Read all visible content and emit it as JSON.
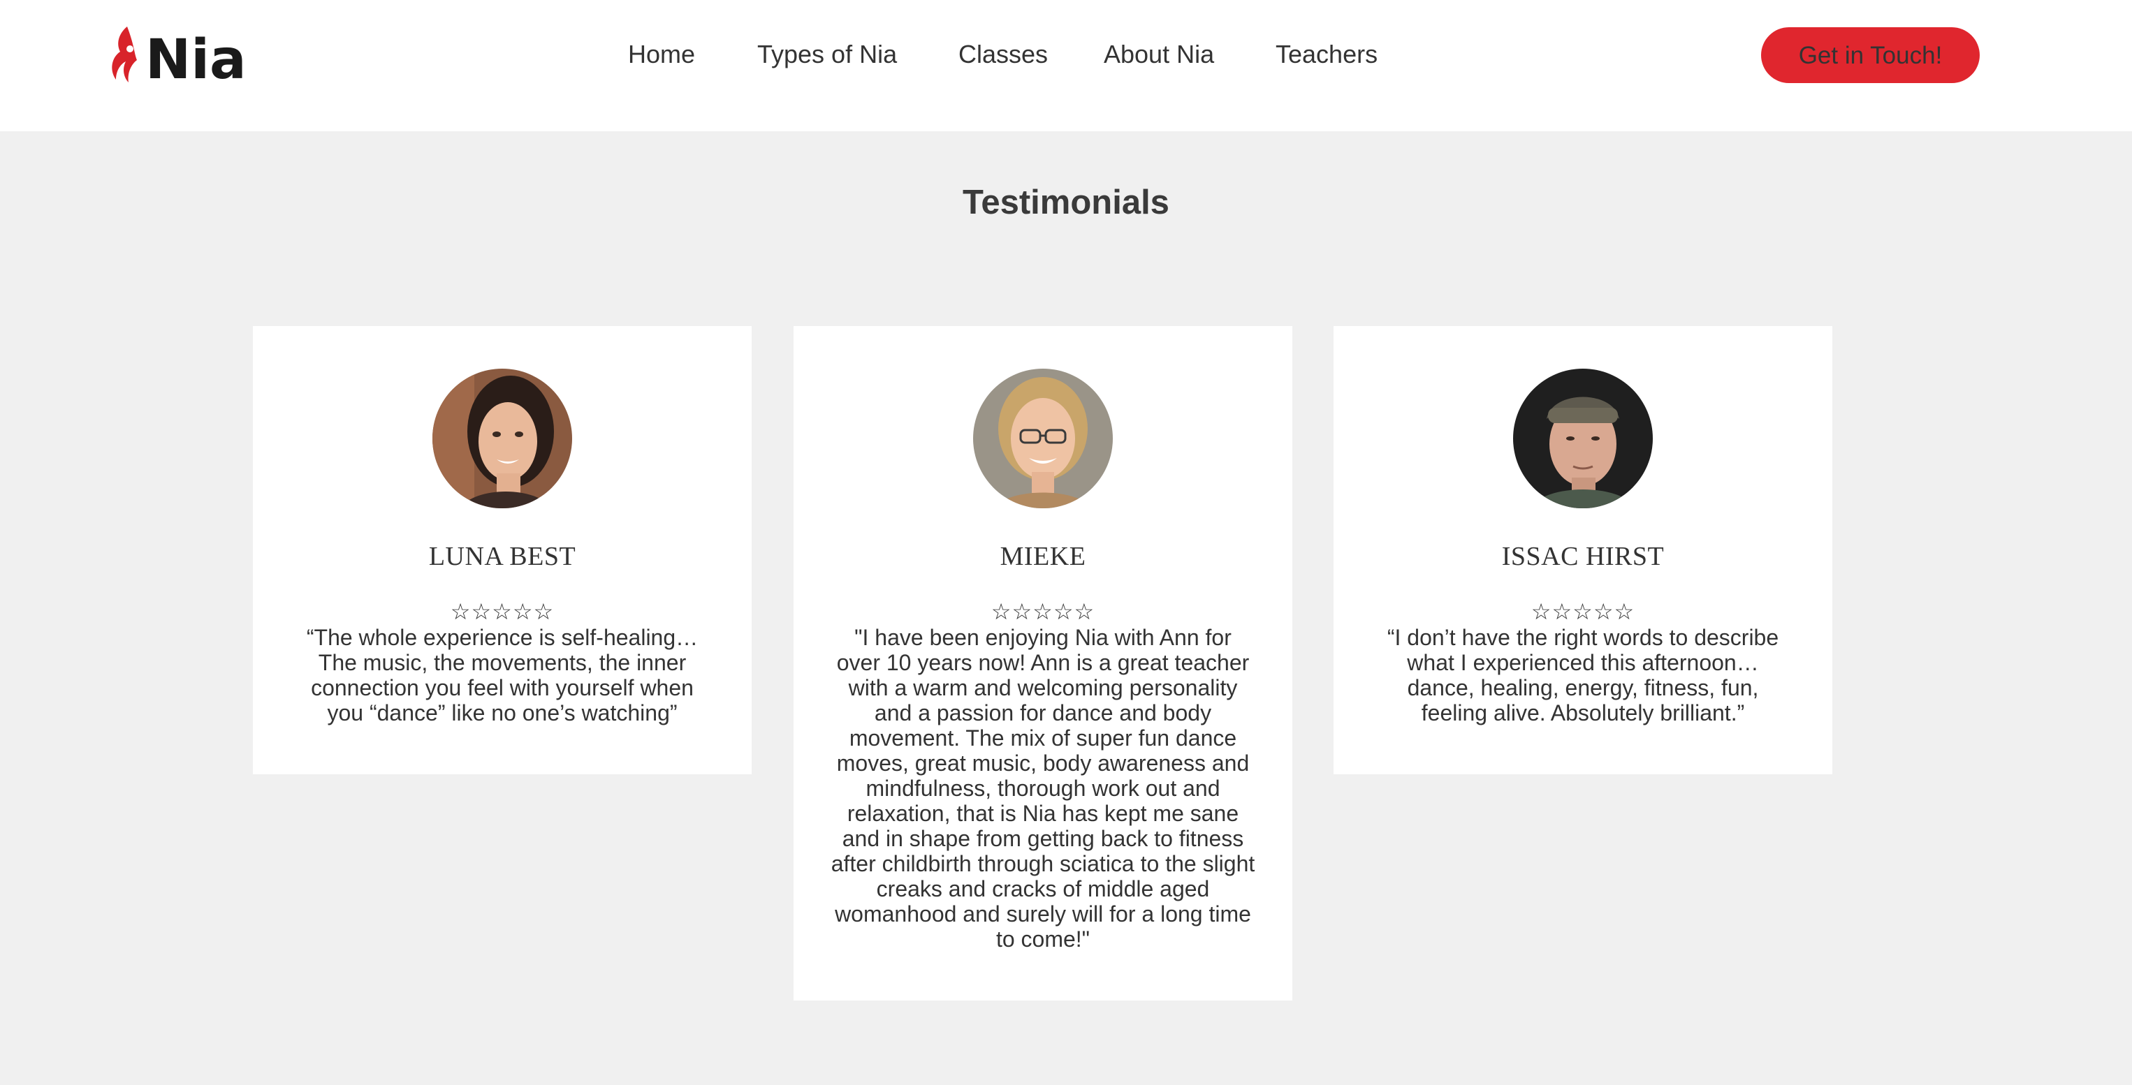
{
  "brand": {
    "name": "Nia",
    "accent_color": "#e0262e"
  },
  "nav": {
    "items": [
      {
        "label": "Home"
      },
      {
        "label": "Types of Nia"
      },
      {
        "label": "Classes"
      },
      {
        "label": "About Nia"
      },
      {
        "label": "Teachers"
      }
    ],
    "cta_label": "Get in Touch!"
  },
  "testimonials": {
    "title": "Testimonials",
    "items": [
      {
        "name": "LUNA BEST",
        "rating_stars": "☆☆☆☆☆",
        "avatar_icon": "woman-portrait",
        "quote": "“The whole experience is self-healing… The music, the movements, the inner connection you feel with yourself when you “dance” like no one’s watching”"
      },
      {
        "name": "MIEKE",
        "rating_stars": "☆☆☆☆☆",
        "avatar_icon": "woman-with-glasses-portrait",
        "quote": "\"I have been enjoying Nia with Ann for over 10 years now! Ann is a great teacher with a warm and welcoming personality and a passion for dance and body movement. The mix of super fun dance moves, great music, body awareness and mindfulness, thorough work out and relaxation, that is Nia has kept me sane and in shape from getting back to fitness after childbirth through sciatica to the slight creaks and cracks of middle aged womanhood and surely will for a long time to come!\""
      },
      {
        "name": "ISSAC HIRST",
        "rating_stars": "☆☆☆☆☆",
        "avatar_icon": "man-with-cap-portrait",
        "quote": "“I don’t have the right words to describe what I experienced this afternoon… dance, healing, energy, fitness, fun, feeling alive. Absolutely brilliant.”"
      }
    ]
  }
}
